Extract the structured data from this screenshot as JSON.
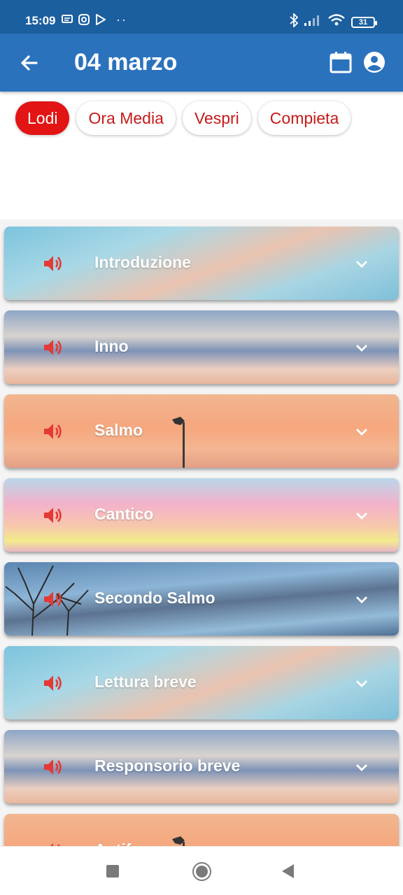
{
  "status_bar": {
    "time": "15:09",
    "battery": "31",
    "dots": "··"
  },
  "app_bar": {
    "title": "04 marzo",
    "icons": [
      "back-arrow-icon",
      "calendar-icon",
      "account-circle-icon"
    ]
  },
  "tabs": [
    {
      "label": "Lodi",
      "active": true
    },
    {
      "label": "Ora Media",
      "active": false
    },
    {
      "label": "Vespri",
      "active": false
    },
    {
      "label": "Compieta",
      "active": false
    }
  ],
  "sections": [
    {
      "label": "Introduzione"
    },
    {
      "label": "Inno"
    },
    {
      "label": "Salmo"
    },
    {
      "label": "Cantico"
    },
    {
      "label": "Secondo Salmo"
    },
    {
      "label": "Lettura breve"
    },
    {
      "label": "Responsorio breve"
    },
    {
      "label": "Antif"
    }
  ],
  "colors": {
    "status_bar": "#1c5f9f",
    "app_bar": "#2b72bd",
    "accent_red": "#e21414",
    "speaker_red": "#e53935"
  }
}
